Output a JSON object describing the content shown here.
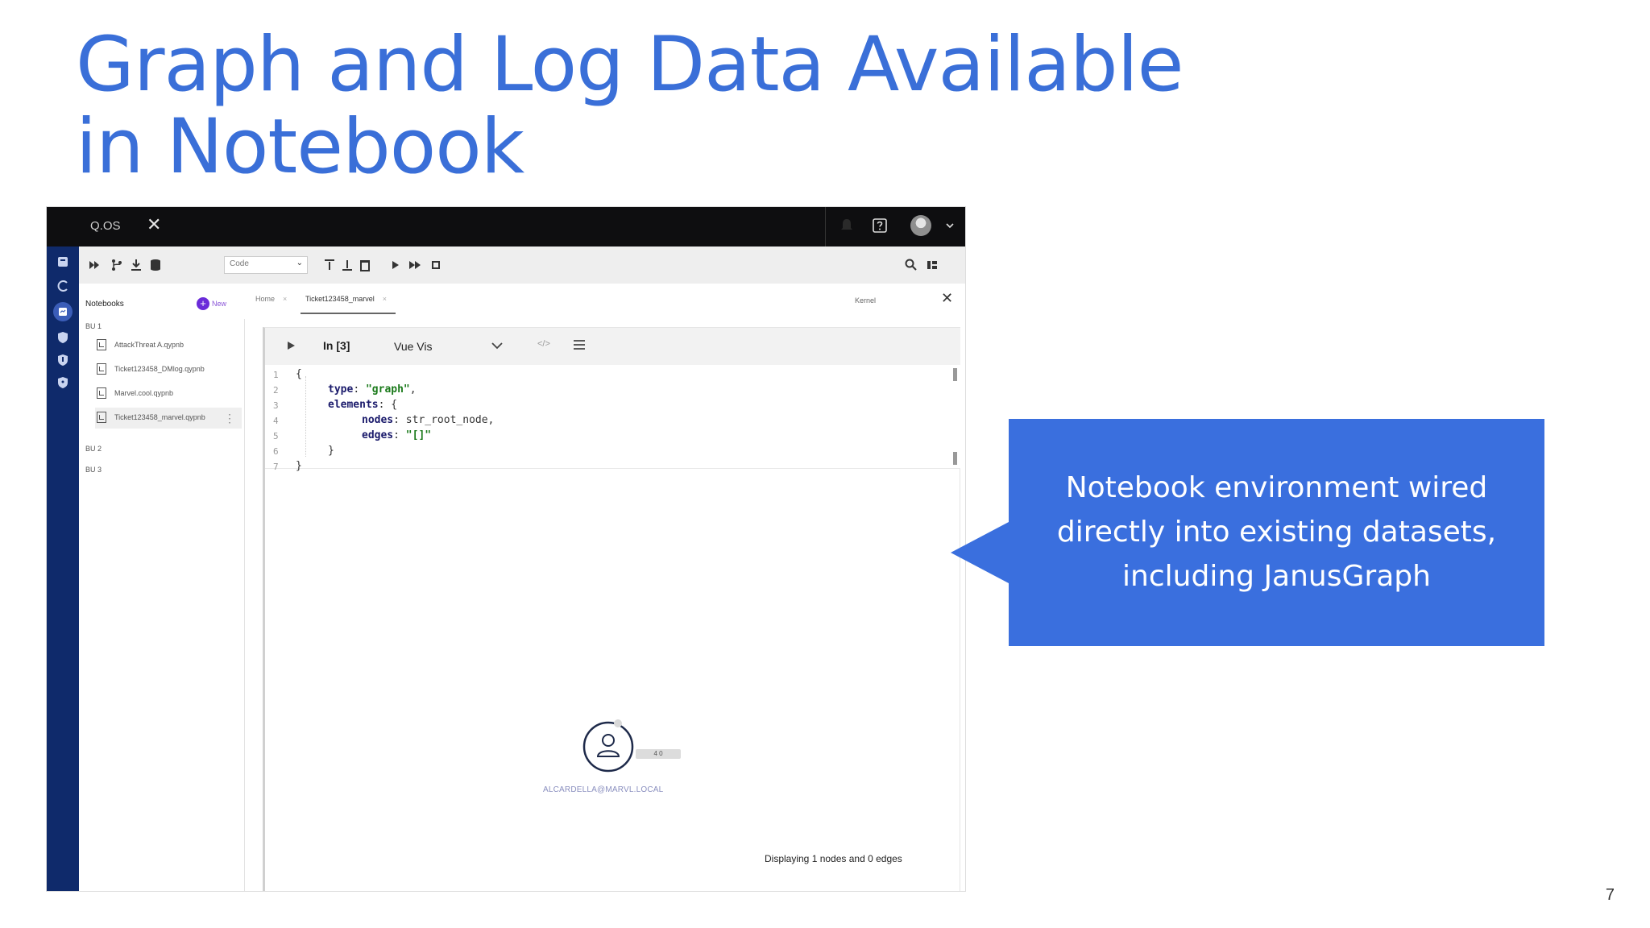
{
  "slide": {
    "title_line1": "Graph and Log Data Available",
    "title_line2": "in Notebook",
    "page_number": "7"
  },
  "app": {
    "name": "Q.OS",
    "close_symbol": "✕"
  },
  "toolbar": {
    "cell_type_select": "Code",
    "caret": "⌄"
  },
  "sidebar": {
    "header": "Notebooks",
    "new_symbol": "+",
    "new_label": "New",
    "groups": [
      "BU 1",
      "BU 2",
      "BU 3"
    ],
    "items": [
      {
        "name": "AttackThreat A.qypnb"
      },
      {
        "name": "Ticket123458_DMlog.qypnb"
      },
      {
        "name": "Marvel.cool.qypnb"
      },
      {
        "name": "Ticket123458_marvel.qypnb"
      }
    ],
    "kebab": "⋮"
  },
  "tabs": {
    "home": "Home",
    "active": "Ticket123458_marvel",
    "close": "×",
    "kernel": "Kernel",
    "panel_close": "✕"
  },
  "cell": {
    "exec_count": "In [3]",
    "type_label": "Vue Vis",
    "code_icon_text": "</>",
    "line_numbers": [
      "1",
      "2",
      "3",
      "4",
      "5",
      "6",
      "7"
    ],
    "code": {
      "l1": "{",
      "l2_key": "type",
      "l2_val": "\"graph\"",
      "l3_key": "elements",
      "l3_rest": ": {",
      "l4_key": "nodes",
      "l4_val": "str_root_node,",
      "l5_key": "edges",
      "l5_val": "\"[]\"",
      "l6": "}",
      "l7": "}"
    }
  },
  "graph": {
    "node_label": "ALCARDELLA@MARVL.LOCAL",
    "node_badge": "4 0",
    "status": "Displaying 1 nodes and 0 edges"
  },
  "callout": {
    "line1": "Notebook environment wired",
    "line2": "directly into existing datasets,",
    "line3": "including JanusGraph"
  },
  "colors": {
    "title": "#3a6fd8",
    "callout_bg": "#3a6fde",
    "rail": "#0f2a6b",
    "topbar": "#0e0e10"
  }
}
